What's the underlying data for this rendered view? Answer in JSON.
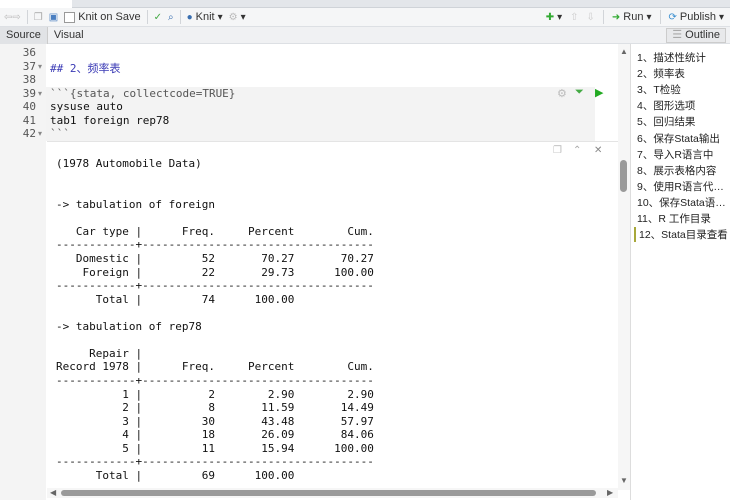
{
  "toolbar": {
    "knit_on_save": "Knit on Save",
    "knit": "Knit",
    "run": "Run",
    "publish": "Publish"
  },
  "modes": {
    "source": "Source",
    "visual": "Visual",
    "outline": "Outline"
  },
  "editor": {
    "line_numbers": [
      "36",
      "37",
      "38",
      "39",
      "40",
      "41",
      "42"
    ],
    "lines": [
      "",
      "## 2、频率表",
      "",
      "```{stata, collectcode=TRUE}",
      "sysuse auto",
      "tab1 foreign rep78",
      "```"
    ]
  },
  "output": {
    "lines": [
      "(1978 Automobile Data)",
      "",
      "",
      "-> tabulation of foreign",
      "",
      "   Car type |      Freq.     Percent        Cum.",
      "------------+-----------------------------------",
      "   Domestic |         52       70.27       70.27",
      "    Foreign |         22       29.73      100.00",
      "------------+-----------------------------------",
      "      Total |         74      100.00",
      "",
      "-> tabulation of rep78",
      "",
      "     Repair |",
      "Record 1978 |      Freq.     Percent        Cum.",
      "------------+-----------------------------------",
      "          1 |          2        2.90        2.90",
      "          2 |          8       11.59       14.49",
      "          3 |         30       43.48       57.97",
      "          4 |         18       26.09       84.06",
      "          5 |         11       15.94      100.00",
      "------------+-----------------------------------",
      "      Total |         69      100.00"
    ]
  },
  "outline": {
    "items": [
      "1、描述性统计",
      "2、频率表",
      "3、T检验",
      "4、图形选项",
      "5、回归结果",
      "6、保存Stata输出",
      "7、导入R语言中",
      "8、展示表格内容",
      "9、使用R语言代…",
      "10、保存Stata语…",
      "11、R 工作目录",
      "12、Stata目录查看"
    ]
  }
}
